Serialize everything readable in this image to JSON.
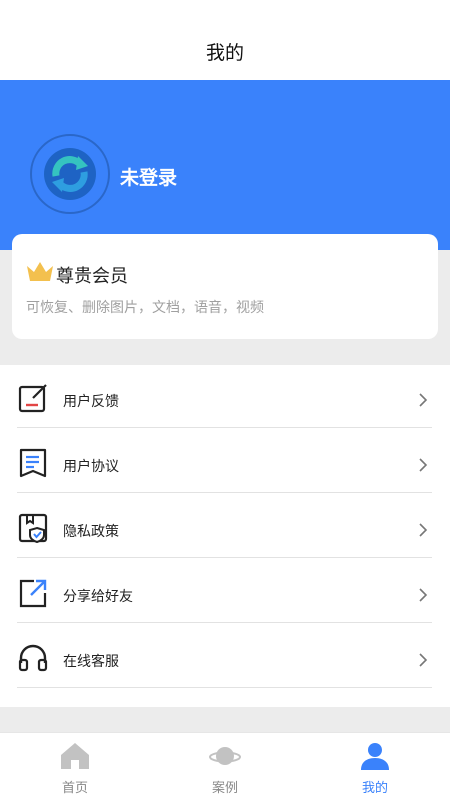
{
  "header": {
    "title": "我的"
  },
  "profile": {
    "login_label": "未登录",
    "avatar_icon": "refresh-logo-icon"
  },
  "vip_card": {
    "icon": "crown-icon",
    "title": "尊贵会员",
    "subtitle": "可恢复、删除图片，文档，语音，视频"
  },
  "menu": {
    "items": [
      {
        "label": "用户反馈",
        "icon": "feedback-edit-icon"
      },
      {
        "label": "用户协议",
        "icon": "agreement-document-icon"
      },
      {
        "label": "隐私政策",
        "icon": "privacy-shield-icon"
      },
      {
        "label": "分享给好友",
        "icon": "share-arrow-icon"
      },
      {
        "label": "在线客服",
        "icon": "headset-icon"
      }
    ]
  },
  "tabbar": {
    "tabs": [
      {
        "label": "首页",
        "icon": "home-icon",
        "active": false
      },
      {
        "label": "案例",
        "icon": "planet-icon",
        "active": false
      },
      {
        "label": "我的",
        "icon": "user-icon",
        "active": true
      }
    ]
  },
  "colors": {
    "accent": "#3a82fb",
    "text": "#222222",
    "muted": "#a0a0a0",
    "divider": "#e2e2e2",
    "crown": "#f3c04e"
  }
}
